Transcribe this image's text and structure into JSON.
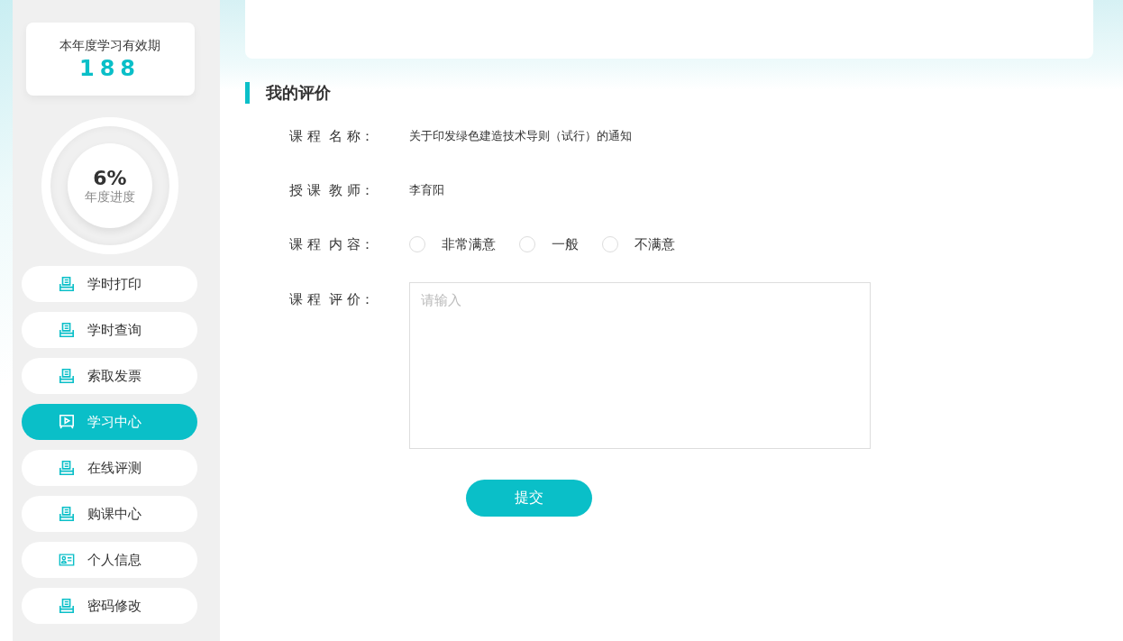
{
  "validity": {
    "label": "本年度学习有效期",
    "value": "188"
  },
  "progress": {
    "value": "6%",
    "label": "年度进度"
  },
  "menu": [
    {
      "label": "学时打印",
      "kind": "doc",
      "selected": false
    },
    {
      "label": "学时查询",
      "kind": "doc",
      "selected": false
    },
    {
      "label": "索取发票",
      "kind": "doc",
      "selected": false
    },
    {
      "label": "学习中心",
      "kind": "play",
      "selected": true
    },
    {
      "label": "在线评测",
      "kind": "doc",
      "selected": false
    },
    {
      "label": "购课中心",
      "kind": "doc",
      "selected": false
    },
    {
      "label": "个人信息",
      "kind": "card",
      "selected": false
    },
    {
      "label": "密码修改",
      "kind": "doc",
      "selected": false
    }
  ],
  "section_title": "我的评价",
  "form": [
    {
      "kind": "text",
      "label": "课 程  名 称：",
      "value": "关于印发绿色建造技术导则（试行）的通知"
    },
    {
      "kind": "text",
      "label": "授 课  教 师：",
      "value": "李育阳"
    },
    {
      "kind": "radio",
      "label": "课 程  内 容：",
      "options": [
        {
          "label": "非常满意",
          "selected": false
        },
        {
          "label": "一般",
          "selected": false
        },
        {
          "label": "不满意",
          "selected": false
        }
      ]
    },
    {
      "kind": "textarea",
      "label": "课 程  评 价：",
      "placeholder": "请输入"
    }
  ],
  "submit": "提交"
}
